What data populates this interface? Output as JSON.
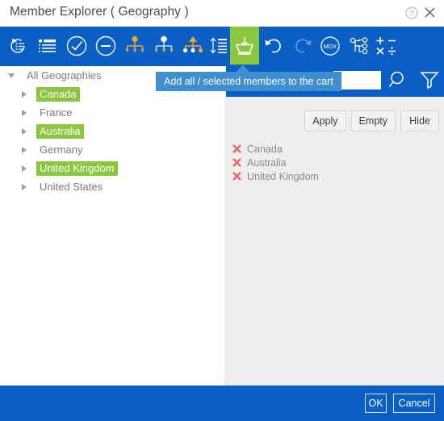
{
  "window": {
    "title": "Member Explorer ( Geography )",
    "help_icon": "help-circle-icon",
    "close_icon": "close-icon",
    "accent_blue": "#095fc4",
    "accent_green": "#8cc63e",
    "tooltip_blue": "#3f8ed0",
    "remove_red": "#f0605d"
  },
  "toolbar": {
    "items": [
      {
        "name": "refresh-members-icon",
        "label": ""
      },
      {
        "name": "flat-list-icon",
        "label": ""
      },
      {
        "name": "check-circle-icon",
        "label": ""
      },
      {
        "name": "minus-circle-icon",
        "label": ""
      },
      {
        "name": "hierarchy-children-icon",
        "label": ""
      },
      {
        "name": "hierarchy-siblings-icon",
        "label": ""
      },
      {
        "name": "hierarchy-parent-icon",
        "label": ""
      },
      {
        "name": "expand-collapse-levels-icon",
        "label": ""
      },
      {
        "name": "add-to-cart-icon",
        "label": ""
      },
      {
        "name": "undo-icon",
        "label": ""
      },
      {
        "name": "redo-icon",
        "label": ""
      },
      {
        "name": "mdx-icon",
        "label": "MDX"
      },
      {
        "name": "named-set-icon",
        "label": ""
      },
      {
        "name": "calculated-member-icon",
        "label": ""
      }
    ],
    "active_tooltip": "Add all / selected members to the cart"
  },
  "search": {
    "value": "",
    "placeholder": "",
    "search_icon": "search-icon",
    "filter_icon": "filter-funnel-icon"
  },
  "tree": {
    "root": {
      "label": "All Geographies",
      "expanded": true,
      "selected": false
    },
    "children": [
      {
        "label": "Canada",
        "selected": true
      },
      {
        "label": "France",
        "selected": false
      },
      {
        "label": "Australia",
        "selected": true
      },
      {
        "label": "Germany",
        "selected": false
      },
      {
        "label": "United Kingdom",
        "selected": true
      },
      {
        "label": "United States",
        "selected": false
      }
    ]
  },
  "cart": {
    "buttons": [
      {
        "name": "apply-button",
        "label": "Apply"
      },
      {
        "name": "empty-button",
        "label": "Empty"
      },
      {
        "name": "hide-button",
        "label": "Hide"
      }
    ],
    "items": [
      {
        "label": "Canada"
      },
      {
        "label": "Australia"
      },
      {
        "label": "United Kingdom"
      }
    ]
  },
  "footer": {
    "ok_label": "OK",
    "cancel_label": "Cancel"
  }
}
